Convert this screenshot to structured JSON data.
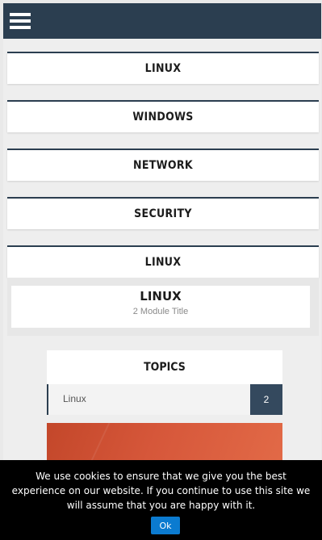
{
  "header": {
    "menu_icon": "hamburger-icon"
  },
  "categories": [
    {
      "label": "LINUX"
    },
    {
      "label": "WINDOWS"
    },
    {
      "label": "NETWORK"
    },
    {
      "label": "SECURITY"
    },
    {
      "label": "LINUX"
    }
  ],
  "module": {
    "title": "LINUX",
    "subtitle": "2 Module Title"
  },
  "topics": {
    "heading": "TOPICS",
    "items": [
      {
        "label": "Linux",
        "count": "2"
      }
    ]
  },
  "cookie_notice": {
    "message": "We use cookies to ensure that we give you the best experience on our website. If you continue to use this site we will assume that you are happy with it.",
    "ok_label": "Ok"
  },
  "colors": {
    "navbar": "#2b3e50",
    "count_badge": "#34495e",
    "ok_button": "#0b7bd0",
    "banner": "#d6573a"
  }
}
